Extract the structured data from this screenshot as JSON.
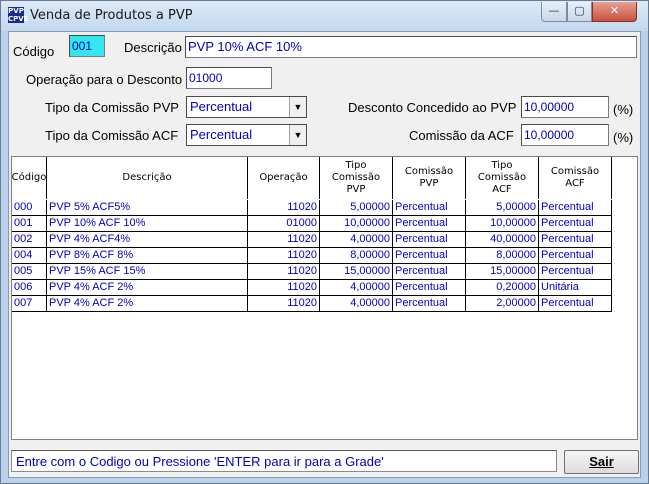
{
  "window": {
    "title": "Venda de Produtos a PVP",
    "icon": "app-icon",
    "controls": {
      "minimize": "—",
      "maximize": "▢",
      "close": "✕"
    }
  },
  "form": {
    "codigo_label": "Código",
    "codigo_value": "001",
    "descricao_label": "Descrição",
    "descricao_value": "PVP 10% ACF 10%",
    "operacao_label": "Operação para o Desconto",
    "operacao_value": "01000",
    "tipo_pvp_label": "Tipo da Comissão PVP",
    "tipo_pvp_value": "Percentual",
    "desconto_label": "Desconto Concedido ao PVP",
    "desconto_value": "10,00000",
    "desconto_unit": "(%)",
    "tipo_acf_label": "Tipo da Comissão ACF",
    "tipo_acf_value": "Percentual",
    "comissao_acf_label": "Comissão da ACF",
    "comissao_acf_value": "10,00000",
    "comissao_acf_unit": "(%)"
  },
  "grid": {
    "headers": [
      "Código",
      "Descrição",
      "Operação",
      "Tipo\nComissão\nPVP",
      "Comissão\nPVP",
      "Tipo\nComissão\nACF",
      "Comissão\nACF"
    ],
    "rows": [
      [
        "000",
        "PVP 5% ACF5%",
        "11020",
        "5,00000",
        "Percentual",
        "5,00000",
        "Percentual"
      ],
      [
        "001",
        "PVP 10% ACF 10%",
        "01000",
        "10,00000",
        "Percentual",
        "10,00000",
        "Percentual"
      ],
      [
        "002",
        "PVP 4% ACF4%",
        "11020",
        "4,00000",
        "Percentual",
        "40,00000",
        "Percentual"
      ],
      [
        "004",
        "PVP  8% ACF  8%",
        "11020",
        "8,00000",
        "Percentual",
        "8,00000",
        "Percentual"
      ],
      [
        "005",
        "PVP  15% ACF  15%",
        "11020",
        "15,00000",
        "Percentual",
        "15,00000",
        "Percentual"
      ],
      [
        "006",
        "PVP  4% ACF   2%",
        "11020",
        "4,00000",
        "Percentual",
        "0,20000",
        "Unitária"
      ],
      [
        "007",
        "PVP  4% ACF  2%",
        "11020",
        "4,00000",
        "Percentual",
        "2,00000",
        "Percentual"
      ]
    ]
  },
  "status": {
    "message": "Entre com o Codigo ou Pressione 'ENTER para ir para a Grade'",
    "exit_label": "Sair"
  }
}
